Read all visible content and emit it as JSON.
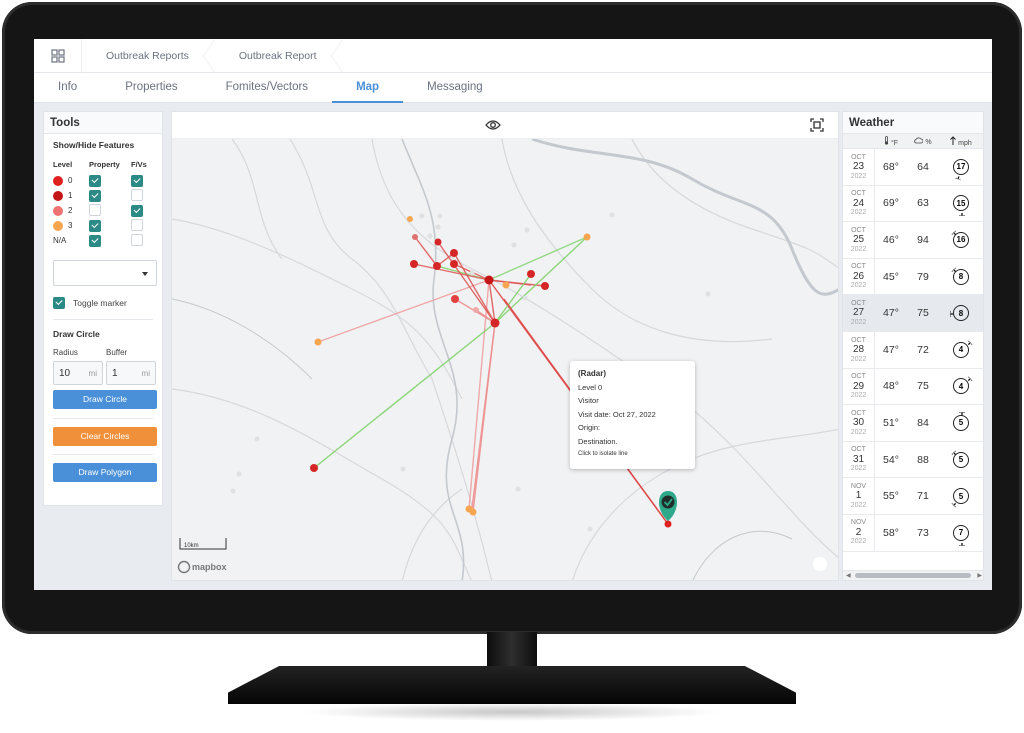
{
  "breadcrumbs": [
    "Outbreak Reports",
    "Outbreak Report"
  ],
  "tabs": [
    "Info",
    "Properties",
    "Fomites/Vectors",
    "Map",
    "Messaging"
  ],
  "active_tab": "Map",
  "tools": {
    "title": "Tools",
    "show_hide_title": "Show/Hide Features",
    "col_level": "Level",
    "col_property": "Property",
    "col_fv": "F/Vs",
    "levels": [
      {
        "label": "0",
        "color": "#e01f1f",
        "property": true,
        "fv": true
      },
      {
        "label": "1",
        "color": "#c41616",
        "property": true,
        "fv": false
      },
      {
        "label": "2",
        "color": "#ef7272",
        "property": false,
        "fv": true
      },
      {
        "label": "3",
        "color": "#f7a54f",
        "property": true,
        "fv": false
      },
      {
        "label": "N/A",
        "color": "",
        "property": true,
        "fv": false
      }
    ],
    "toggle_marker": "Toggle marker",
    "draw_circle_title": "Draw Circle",
    "radius_label": "Radius",
    "buffer_label": "Buffer",
    "radius_value": "10",
    "buffer_value": "1",
    "unit": "mi",
    "draw_circle_btn": "Draw Circle",
    "clear_circles_btn": "Clear Circles",
    "draw_polygon_btn": "Draw Polygon"
  },
  "map": {
    "scale_label": "10km",
    "attribution": "mapbox",
    "popup": {
      "title": "(Radar)",
      "level": "Level 0",
      "type": "Visitor",
      "visit_date": "Visit date: Oct 27, 2022",
      "origin": "Origin:",
      "destination": "Destination.",
      "hint": "Click to isolate line"
    }
  },
  "weather": {
    "title": "Weather",
    "temp_unit": "°F",
    "humidity_unit": "%",
    "wind_unit": "mph",
    "days": [
      {
        "month": "OCT",
        "day": "23",
        "year": "2022",
        "temp": "68°",
        "humidity": "64",
        "wind": "17",
        "dir": 200
      },
      {
        "month": "OCT",
        "day": "24",
        "year": "2022",
        "temp": "69°",
        "humidity": "63",
        "wind": "15",
        "dir": 180
      },
      {
        "month": "OCT",
        "day": "25",
        "year": "2022",
        "temp": "46°",
        "humidity": "94",
        "wind": "16",
        "dir": 315
      },
      {
        "month": "OCT",
        "day": "26",
        "year": "2022",
        "temp": "45°",
        "humidity": "79",
        "wind": "8",
        "dir": 315
      },
      {
        "month": "OCT",
        "day": "27",
        "year": "2022",
        "temp": "47°",
        "humidity": "75",
        "wind": "8",
        "dir": 270
      },
      {
        "month": "OCT",
        "day": "28",
        "year": "2022",
        "temp": "47°",
        "humidity": "72",
        "wind": "4",
        "dir": 45
      },
      {
        "month": "OCT",
        "day": "29",
        "year": "2022",
        "temp": "48°",
        "humidity": "75",
        "wind": "4",
        "dir": 45
      },
      {
        "month": "OCT",
        "day": "30",
        "year": "2022",
        "temp": "51°",
        "humidity": "84",
        "wind": "5",
        "dir": 0
      },
      {
        "month": "OCT",
        "day": "31",
        "year": "2022",
        "temp": "54°",
        "humidity": "88",
        "wind": "5",
        "dir": 315
      },
      {
        "month": "NOV",
        "day": "1",
        "year": "2022",
        "temp": "55°",
        "humidity": "71",
        "wind": "5",
        "dir": 225
      },
      {
        "month": "NOV",
        "day": "2",
        "year": "2022",
        "temp": "58°",
        "humidity": "73",
        "wind": "7",
        "dir": 180
      }
    ],
    "selected_index": 4
  }
}
